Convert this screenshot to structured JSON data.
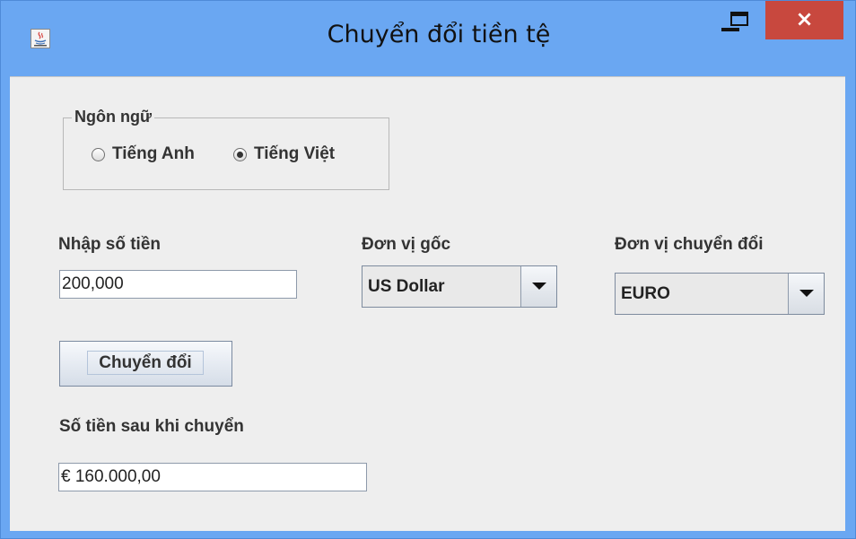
{
  "window": {
    "title": "Chuyển đổi tiền tệ",
    "controls": {
      "minimize_icon": "minimize-icon",
      "maximize_icon": "maximize-icon",
      "close_label": "×"
    }
  },
  "language": {
    "group_label": "Ngôn ngữ",
    "options": [
      {
        "label": "Tiếng Anh",
        "selected": false
      },
      {
        "label": "Tiếng Việt",
        "selected": true
      }
    ]
  },
  "amount": {
    "label": "Nhập số tiền",
    "value": "200,000"
  },
  "source_unit": {
    "label": "Đơn vị gốc",
    "value": "US Dollar"
  },
  "target_unit": {
    "label": "Đơn vị chuyển đổi",
    "value": "EURO"
  },
  "convert_button": {
    "label": "Chuyển đổi"
  },
  "result": {
    "label": "Số tiền sau khi chuyển",
    "value": "€ 160.000,00"
  },
  "colors": {
    "titlebar": "#6aa7f2",
    "close_button": "#c8483e",
    "content_bg": "#eeeeee"
  }
}
